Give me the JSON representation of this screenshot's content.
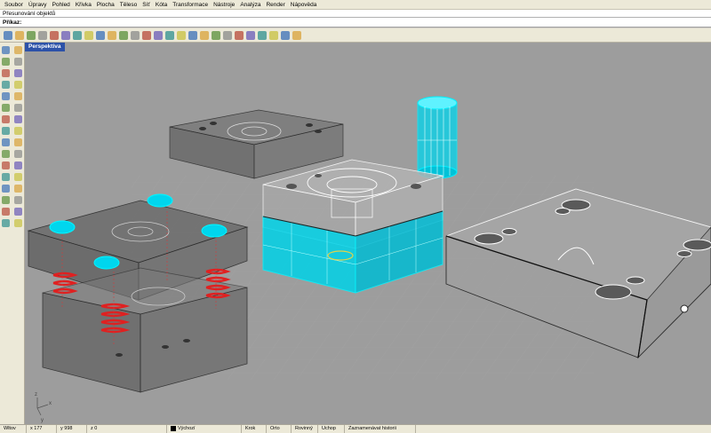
{
  "menu": [
    "Soubor",
    "Úpravy",
    "Pohled",
    "Křivka",
    "Plocha",
    "Těleso",
    "Síť",
    "Kóta",
    "Transformace",
    "Nástroje",
    "Analýza",
    "Render",
    "Nápověda"
  ],
  "command_history": "Přesunování objektů",
  "command_prompt": "Příkaz:",
  "viewport": {
    "title": "Perspektiva",
    "axis_x": "x",
    "axis_y": "y",
    "axis_z": "z"
  },
  "status": {
    "cplane": "Wltov",
    "x": "x 177",
    "y": "y 998",
    "z": "z 0",
    "layer": "Výchozí",
    "snap": "Krok",
    "ortho": "Orto",
    "planar": "Rovinný",
    "osnap": "Uchop",
    "history": "Zaznamenávat historii"
  },
  "colors": {
    "viewport_bg": "#9d9d9d",
    "selection": "#00e5ff",
    "spring": "#e02020",
    "title_bar": "#2d52a8"
  },
  "toolbar_icons": [
    "new-icon",
    "open-icon",
    "save-icon",
    "print-icon",
    "import-icon",
    "cut-icon",
    "copy-icon",
    "paste-icon",
    "undo-icon",
    "pan-icon",
    "rotate-icon",
    "zoom-icon",
    "zoom-window-icon",
    "zoom-extents-icon",
    "zoom-selected-icon",
    "redraw-icon",
    "grid-icon",
    "snap-icon",
    "display-icon",
    "light-icon",
    "color-icon",
    "material-icon",
    "render-icon",
    "sphere-icon",
    "ortho-icon",
    "help-icon"
  ],
  "side_icons": [
    "select-icon",
    "point-icon",
    "polyline-icon",
    "curve-icon",
    "circle-icon",
    "arc-icon",
    "ellipse-icon",
    "rectangle-icon",
    "polygon-icon",
    "curve-edit-icon",
    "surface-icon",
    "loft-icon",
    "box-icon",
    "cylinder-icon",
    "boolean-icon",
    "fillet-icon",
    "mesh-icon",
    "dim-icon",
    "move-icon",
    "copy-icon",
    "rotate-icon",
    "scale-icon",
    "mirror-icon",
    "array-icon",
    "trim-icon",
    "split-icon",
    "join-icon",
    "explode-icon",
    "group-icon",
    "layer-icon",
    "properties-icon",
    "analyze-icon"
  ]
}
